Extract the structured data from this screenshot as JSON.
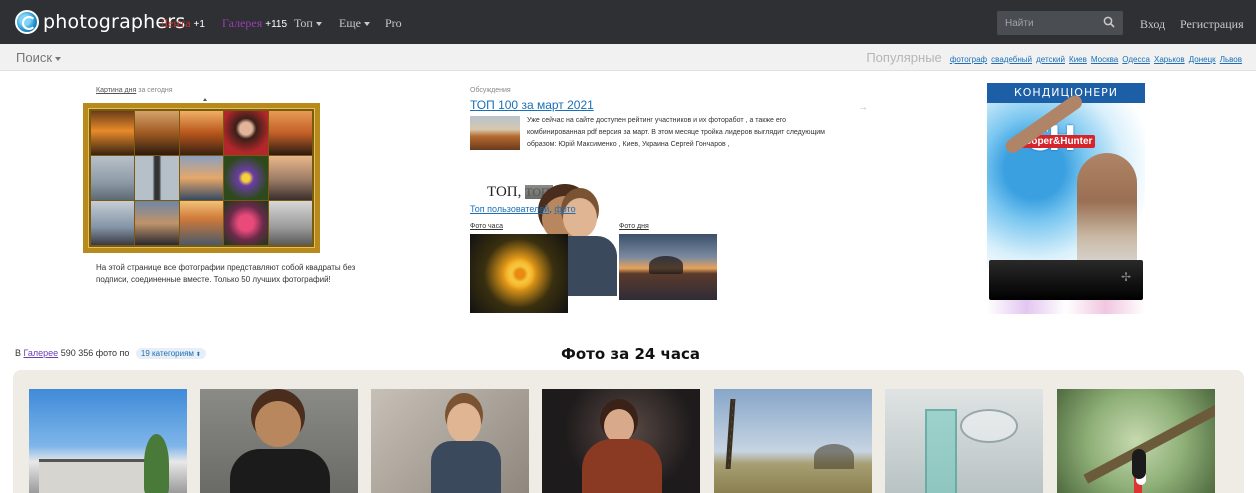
{
  "header": {
    "logo_text": "photographers",
    "nav": [
      {
        "label": "Лента",
        "count": "+1",
        "color": "#d0342c"
      },
      {
        "label": "Галерея",
        "count": "+115",
        "color": "#9b3bb5"
      },
      {
        "label": "Топ"
      },
      {
        "label": "Еще"
      },
      {
        "label": "Pro"
      }
    ],
    "search_placeholder": "Найти",
    "login": "Вход",
    "register": "Регистрация"
  },
  "subbar": {
    "search_label": "Поиск",
    "popular_label": "Популярные",
    "tags": [
      "фотограф",
      "свадебный",
      "детский",
      "Киев",
      "Москва",
      "Одесса",
      "Харьков",
      "Донецк",
      "Львов"
    ]
  },
  "picture_of_day": {
    "link": "Картина дня",
    "suffix": "за сегодня",
    "description": "На этой странице все фотографии представляют собой квадраты без подписи, соединенные вместе. Только 50 лучших фотографий!"
  },
  "discussions": {
    "label": "Обсуждения",
    "title": "ТОП 100 за март 2021",
    "text": "Уже сейчас на сайте доступен рейтинг участников и их фоторабот , а также его комбинированная pdf версия за март. В этом месяце тройка лидеров выглядит следующим образом: Юрій Максименко , Киев, Украина Сергей Гончаров ,",
    "arrow": "→"
  },
  "top_block": {
    "t1": "ТОП,",
    "t2": "ТОП,",
    "t3": "топ...",
    "link_users": "Топ пользователей",
    "sep": ", ",
    "link_photo": "фото",
    "hour_label": "Фото часа",
    "day_label": "Фото дня"
  },
  "ad": {
    "headline": "КОНДИЦІОНЕРИ",
    "logo": "CH",
    "brand": "Cooper&Hunter"
  },
  "gallery": {
    "prefix": "В",
    "link": "Галерее",
    "count_text": "590 356 фото по",
    "categories": "19 категориям",
    "heading": "Фото за 24 часа"
  },
  "colors": {
    "topbar": "#2e3033",
    "link": "#1a6fb8",
    "strip_bg": "#efece6",
    "frame": "#b88a1c"
  }
}
